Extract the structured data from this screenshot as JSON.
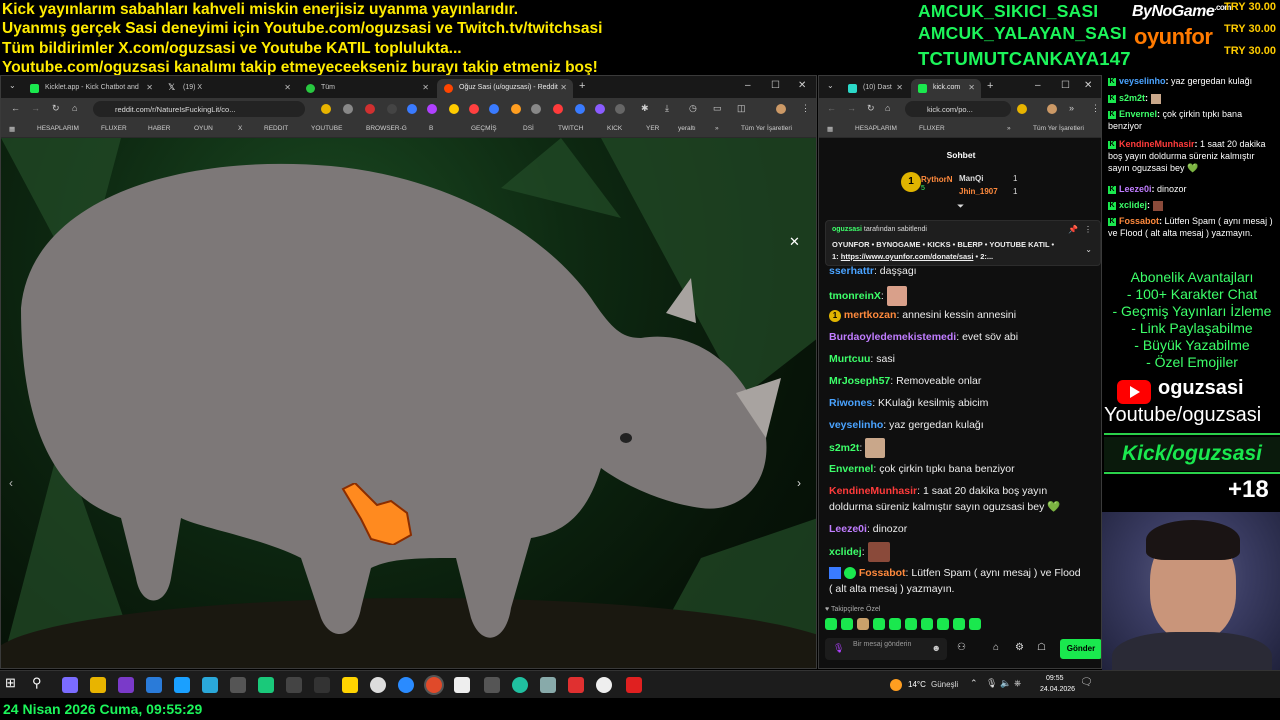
{
  "banner": {
    "line1": "Kick yayınlarım sabahları kahveli miskin enerjisiz uyanma yayınlarıdır.",
    "line2": "Uyanmış gerçek Sasi deneyimi için Youtube.com/oguzsasi ve Twitch.tv/twitchsasi",
    "line3": "Tüm bildirimler X.com/oguzsasi ve Youtube KATIL toplulukta...",
    "line4": "Youtube.com/oguzsasi kanalımı takip etmeyeceekseniz burayı takip etmeniz boş!"
  },
  "top_names": [
    "AMCUK_SIKICI_SASI",
    "AMCUK_YALAYAN_SASI",
    "TCTUMUTCANKAYA147"
  ],
  "sponsor": {
    "bynogame": "ByNoGame",
    "com": ".com",
    "oyunfor": "oyunfor"
  },
  "try_values": [
    "TRY 30.00",
    "TRY 30.00",
    "TRY 30.00"
  ],
  "left_browser": {
    "tabs": [
      {
        "label": "Kicklet.app - Kick Chatbot and",
        "color": "#1ae84e"
      },
      {
        "label": "(19) X",
        "color": "#e0e0e0"
      },
      {
        "label": "Tüm",
        "color": "#28c840"
      },
      {
        "label": "Oğuz Sasi (u/oguzsasi) - Reddit",
        "color": "#ff4500"
      }
    ],
    "url": "reddit.com/r/NatureIsFuckingLit/co...",
    "bookmarks": [
      "HESAPLARIM",
      "FLUXER",
      "HABER",
      "OYUN",
      "X",
      "REDDIT",
      "YOUTUBE",
      "BROWSER-G",
      "B",
      "GEÇMİŞ",
      "DSİ",
      "TWITCH",
      "KICK",
      "YER",
      "yeraltı",
      "Tüm Yer İşaretleri"
    ]
  },
  "right_browser": {
    "tabs": [
      {
        "label": "(10) Dast",
        "color": "#2bd9c8"
      },
      {
        "label": "kick.com",
        "color": "#1ae84e"
      }
    ],
    "url": "kick.com/po...",
    "bookmarks": [
      "HESAPLARIM",
      "FLUXER",
      "Tüm Yer İşaretleri"
    ]
  },
  "chat": {
    "header": "Sohbet",
    "gifters": [
      {
        "rank": "1",
        "name": "RythorN",
        "count": "5"
      },
      {
        "rank": "",
        "name": "ManQi",
        "count": "1"
      },
      {
        "rank": "",
        "name": "Jhin_1907",
        "count": "1"
      }
    ],
    "pinned": {
      "author": "oguzsasi",
      "suffix": "tarafından sabitlendi",
      "text1": "OYUNFOR • BYNOGAME • KICKS • BLERP • YOUTUBE KATIL •",
      "text2_prefix": "1: ",
      "text2_link": "https://www.oyunfor.com/donate/sasi",
      "text2_suffix": " • 2:..."
    },
    "messages": [
      {
        "user": "sserhattr",
        "color": "#4aa3ff",
        "text": "daşşagı"
      },
      {
        "user": "tmonreinX",
        "color": "#3dff6a",
        "text": ""
      },
      {
        "user": "mertkozan",
        "color": "#ff8a3d",
        "text": "annesini kessin annesini"
      },
      {
        "user": "Burdaoyledemekistemedi",
        "color": "#c07dff",
        "text": "evet söv abi"
      },
      {
        "user": "Murtcuu",
        "color": "#3dff6a",
        "text": "sasi"
      },
      {
        "user": "MrJoseph57",
        "color": "#3dff6a",
        "text": "Removeable onlar"
      },
      {
        "user": "Riwones",
        "color": "#4aa3ff",
        "text": "KKulağı kesilmiş abicim"
      },
      {
        "user": "veyselinho",
        "color": "#4aa3ff",
        "text": "yaz gergedan kulağı"
      },
      {
        "user": "s2m2t",
        "color": "#3dff6a",
        "text": ""
      },
      {
        "user": "Envernel",
        "color": "#3dff6a",
        "text": "çok çirkin tıpkı bana benziyor"
      },
      {
        "user": "KendineMunhasir",
        "color": "#ff3b3b",
        "text": "1 saat 20 dakika boş yayın",
        "text2": "doldurma süreniz kalmıştır sayın oguzsasi bey 💚"
      },
      {
        "user": "Leeze0i",
        "color": "#c07dff",
        "text": "dinozor"
      },
      {
        "user": "xclidej",
        "color": "#3dff6a",
        "text": ""
      },
      {
        "user": "Fossabot",
        "color": "#ff8a3d",
        "text": "Lütfen Spam ( aynı mesaj ) ve Flood",
        "text2": "( alt alta mesaj ) yazmayın."
      }
    ],
    "emote_label": "Takipçilere Özel",
    "input_placeholder": "Bir mesaj gönderin",
    "send": "Gönder"
  },
  "side_chat": [
    {
      "user": "veyselinho",
      "color": "#4aa3ff",
      "text": "yaz gergedan kulağı"
    },
    {
      "user": "s2m2t",
      "color": "#3dff6a",
      "text": ""
    },
    {
      "user": "Envernel",
      "color": "#3dff6a",
      "text": "çok çirkin tıpkı bana benziyor"
    },
    {
      "user": "KendineMunhasir",
      "color": "#ff3b3b",
      "text": "1 saat 20 dakika boş yayın doldurma süreniz kalmıştır sayın oguzsasi bey 💚"
    },
    {
      "user": "Leeze0i",
      "color": "#c07dff",
      "text": "dinozor"
    },
    {
      "user": "xclidej",
      "color": "#3dff6a",
      "text": ""
    },
    {
      "user": "Fossabot",
      "color": "#ff8a3d",
      "text": "Lütfen Spam ( aynı mesaj ) ve Flood ( alt alta mesaj ) yazmayın."
    }
  ],
  "benefits": {
    "title": "Abonelik Avantajları",
    "items": [
      "- 100+ Karakter Chat",
      "- Geçmiş Yayınları İzleme",
      "- Link Paylaşabilme",
      "- Büyük Yazabilme",
      "- Özel Emojiler"
    ]
  },
  "youtube": {
    "handle": "oguzsasi",
    "channel": "Youtube/oguzsasi"
  },
  "kick_handle": "Kick/oguzsasi",
  "age": "+18",
  "taskbar": {
    "weather": "14°C",
    "weather_label": "Güneşli",
    "time": "09:55",
    "date": "24.04.2026"
  },
  "bottom_clock": "24 Nisan 2026 Cuma, 09:55:29"
}
